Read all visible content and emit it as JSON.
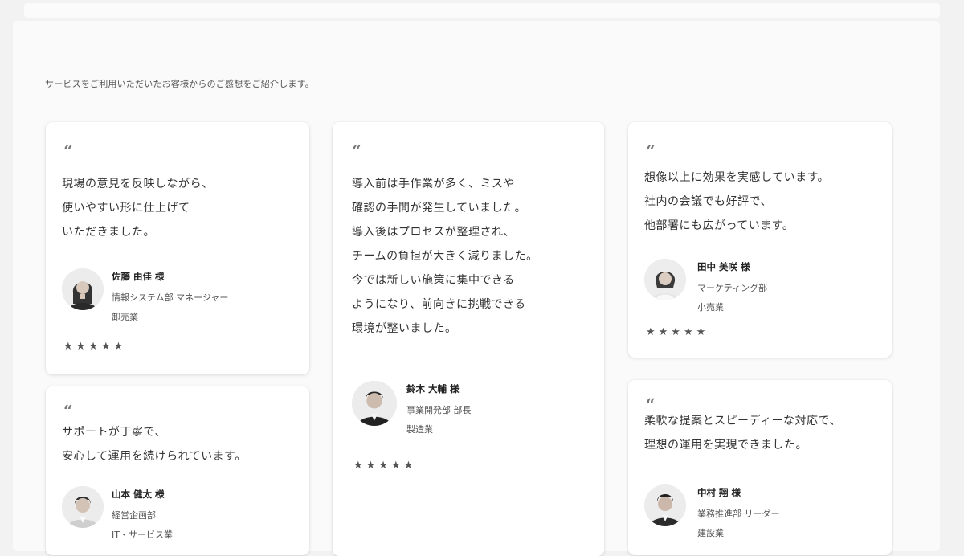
{
  "intro": "サービスをご利用いただいたお客様からのご感想をご紹介します。",
  "quote_mark": "“",
  "cards": [
    {
      "lines": [
        "現場の意見を反映しながら、",
        "使いやすい形に仕上げて",
        "いただきました。"
      ],
      "name": "佐藤 由佳 様",
      "dept": "情報システム部 マネージャー",
      "industry": "卸売業",
      "stars": "★★★★★"
    },
    {
      "lines": [
        "導入前は手作業が多く、ミスや",
        "確認の手間が発生していました。",
        "導入後はプロセスが整理され、",
        "チームの負担が大きく減りました。",
        "今では新しい施策に集中できる",
        "ようになり、前向きに挑戦できる",
        "環境が整いました。"
      ],
      "name": "鈴木 大輔 様",
      "dept": "事業開発部 部長",
      "industry": "製造業",
      "stars": "★★★★★"
    },
    {
      "lines": [
        "想像以上に効果を実感しています。",
        "社内の会議でも好評で、",
        "他部署にも広がっています。"
      ],
      "name": "田中 美咲 様",
      "dept": "マーケティング部",
      "industry": "小売業",
      "stars": "★★★★★"
    },
    {
      "lines": [
        "サポートが丁寧で、",
        "安心して運用を続けられています。"
      ],
      "name": "山本 健太 様",
      "dept": "経営企画部",
      "industry": "IT・サービス業",
      "stars": ""
    },
    {
      "lines": [
        "柔軟な提案とスピーディーな対応で、",
        "理想の運用を実現できました。"
      ],
      "name": "中村 翔 様",
      "dept": "業務推進部 リーダー",
      "industry": "建設業",
      "stars": ""
    }
  ]
}
